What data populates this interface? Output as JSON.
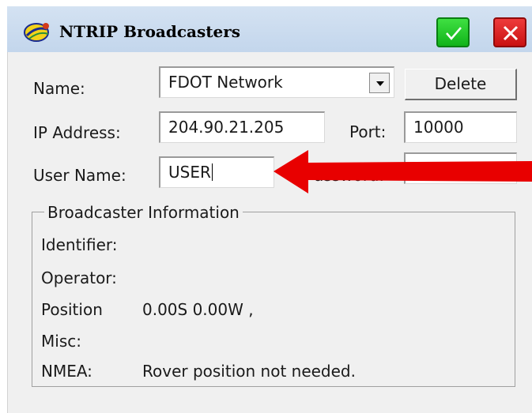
{
  "window": {
    "title": "NTRIP Broadcasters",
    "icons": {
      "app": "satellite-dish-icon",
      "ok": "checkmark-icon",
      "close": "x-icon"
    },
    "colors": {
      "title_bar": "#c9dbef",
      "ok": "#22c02a",
      "close": "#dd2424",
      "arrow": "#e80000"
    }
  },
  "form": {
    "name_label": "Name:",
    "name_value": "FDOT Network",
    "delete_label": "Delete",
    "ip_label": "IP Address:",
    "ip_value": "204.90.21.205",
    "port_label": "Port:",
    "port_value": "10000",
    "user_label": "User Name:",
    "user_value": "USER",
    "password_label_partial": "Password:"
  },
  "broadcaster_info": {
    "legend": "Broadcaster Information",
    "identifier_label": "Identifier:",
    "identifier_value": "",
    "operator_label": "Operator:",
    "operator_value": "",
    "position_label": "Position",
    "position_value": "0.00S 0.00W ,",
    "misc_label": "Misc:",
    "misc_value": "",
    "nmea_label": "NMEA:",
    "nmea_value": "Rover position not needed."
  },
  "annotation": {
    "arrow_icon": "red-arrow-left-icon"
  }
}
